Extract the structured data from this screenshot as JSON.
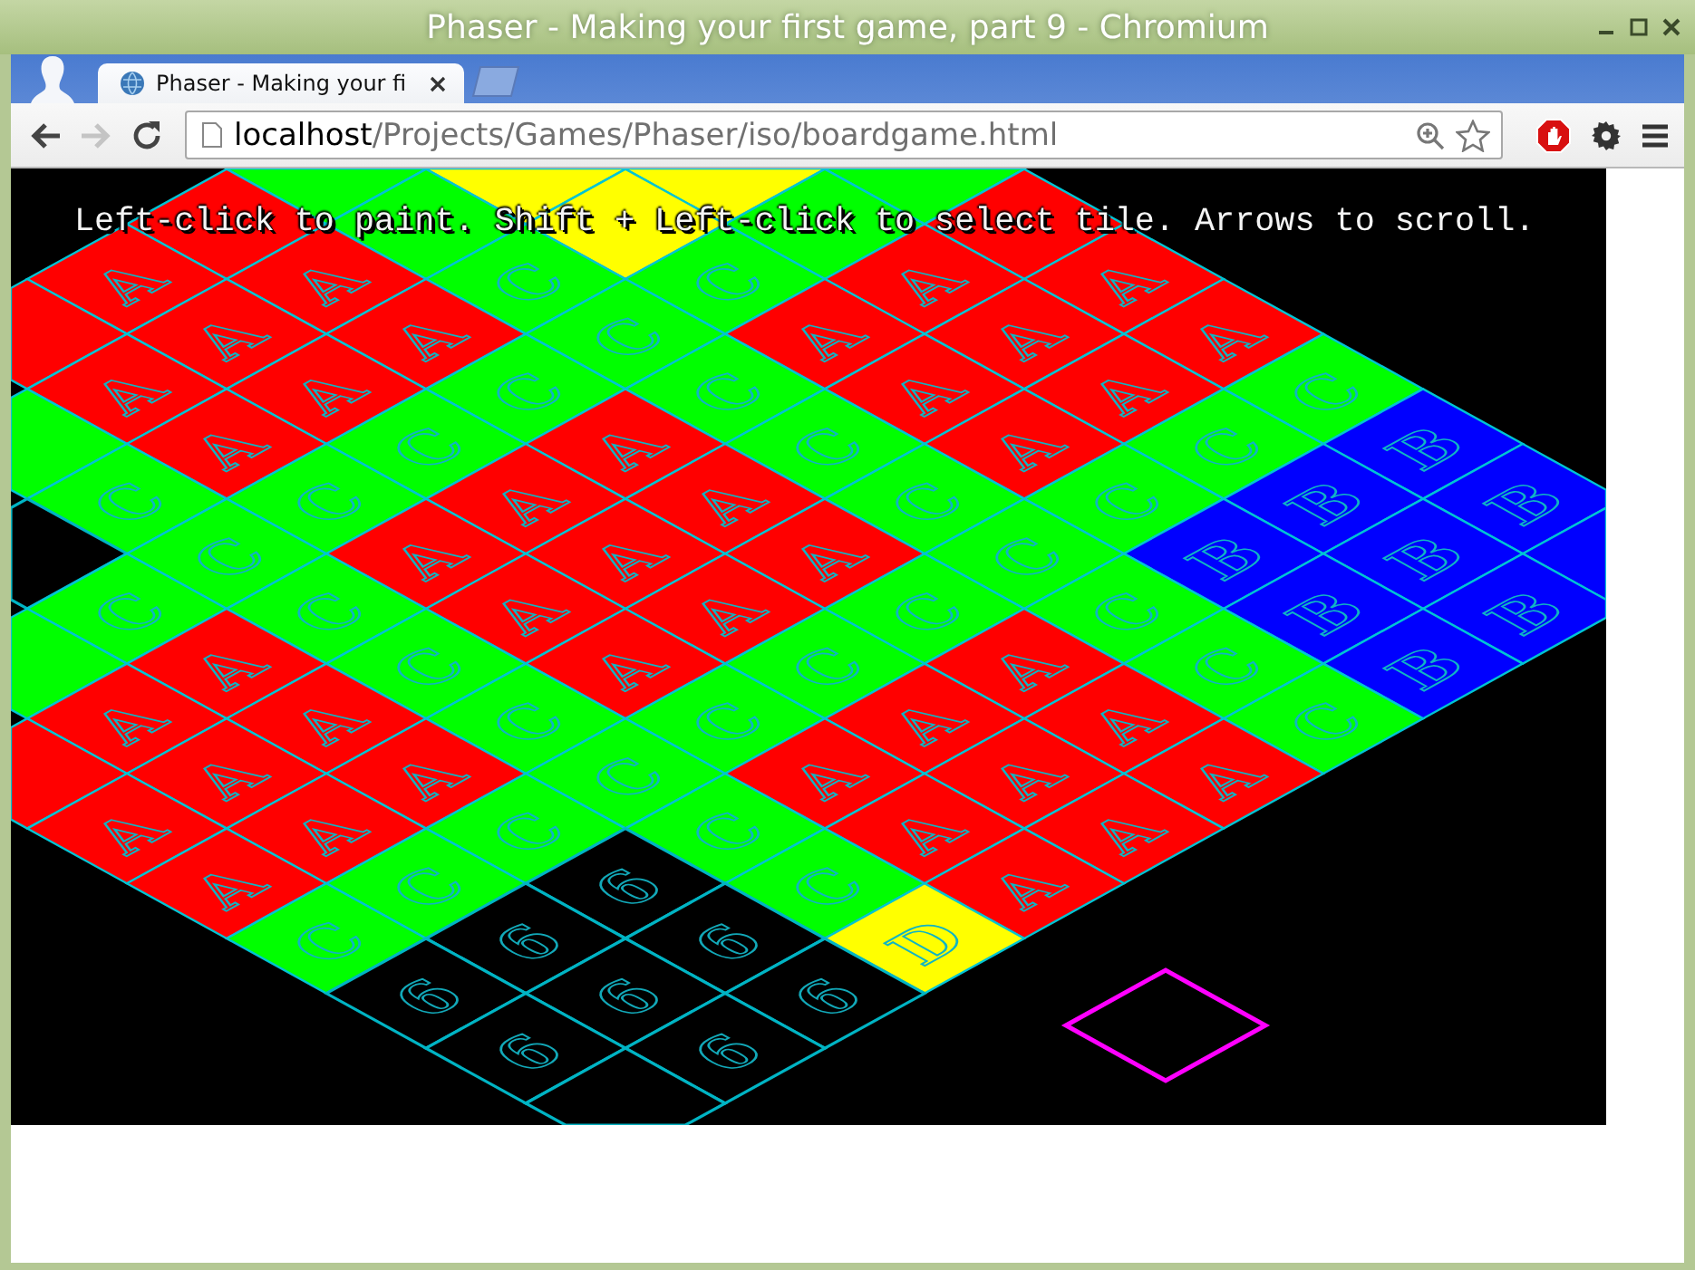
{
  "window": {
    "title": "Phaser - Making your first game, part 9 - Chromium"
  },
  "tabs": [
    {
      "title": "Phaser - Making your fi",
      "selected": true
    }
  ],
  "toolbar": {
    "back": {
      "disabled": false
    },
    "forward": {
      "disabled": true
    }
  },
  "address": {
    "host": "localhost",
    "path": "/Projects/Games/Phaser/iso/boardgame.html"
  },
  "game": {
    "hint": "Left-click to paint. Shift + Left-click to select tile. Arrows to scroll.",
    "board": {
      "rows": [
        [
          {
            "kind": "none"
          },
          {
            "kind": "filled",
            "color": "#00ff00"
          },
          {
            "kind": "filled",
            "color": "#ffff00"
          },
          {
            "kind": "filled",
            "color": "#ffff00"
          },
          {
            "kind": "filled",
            "color": "#00ff00"
          }
        ],
        [
          {
            "kind": "none"
          },
          {
            "kind": "filled",
            "color": "#ff0000"
          },
          {
            "kind": "filled",
            "color": "#00ff00"
          },
          {
            "kind": "filled",
            "color": "#ffff00"
          },
          {
            "kind": "filled",
            "color": "#00ff00"
          },
          {
            "kind": "filled",
            "color": "#ff0000"
          }
        ],
        [
          {
            "kind": "filled",
            "color": "#ff0000",
            "letter": "A"
          },
          {
            "kind": "filled",
            "color": "#ff0000",
            "letter": "A"
          },
          {
            "kind": "filled",
            "color": "#00ff00",
            "letter": "C"
          },
          {
            "kind": "filled",
            "color": "#00ff00",
            "letter": "C"
          },
          {
            "kind": "filled",
            "color": "#ff0000",
            "letter": "A"
          },
          {
            "kind": "filled",
            "color": "#ff0000",
            "letter": "A"
          }
        ],
        [
          {
            "kind": "filled",
            "color": "#ff0000"
          },
          {
            "kind": "filled",
            "color": "#ff0000",
            "letter": "A"
          },
          {
            "kind": "filled",
            "color": "#ff0000",
            "letter": "A"
          },
          {
            "kind": "filled",
            "color": "#00ff00",
            "letter": "C"
          },
          {
            "kind": "filled",
            "color": "#ff0000",
            "letter": "A"
          },
          {
            "kind": "filled",
            "color": "#ff0000",
            "letter": "A"
          },
          {
            "kind": "filled",
            "color": "#ff0000",
            "letter": "A"
          }
        ],
        [
          {
            "kind": "filled",
            "color": "#ff0000",
            "letter": "A"
          },
          {
            "kind": "filled",
            "color": "#ff0000",
            "letter": "A"
          },
          {
            "kind": "filled",
            "color": "#00ff00",
            "letter": "C"
          },
          {
            "kind": "filled",
            "color": "#00ff00",
            "letter": "C"
          },
          {
            "kind": "filled",
            "color": "#ff0000",
            "letter": "A"
          },
          {
            "kind": "filled",
            "color": "#ff0000",
            "letter": "A"
          },
          {
            "kind": "filled",
            "color": "#00ff00",
            "letter": "C"
          }
        ],
        [
          {
            "kind": "filled",
            "color": "#00ff00"
          },
          {
            "kind": "filled",
            "color": "#ff0000",
            "letter": "A"
          },
          {
            "kind": "filled",
            "color": "#00ff00",
            "letter": "C"
          },
          {
            "kind": "filled",
            "color": "#ff0000",
            "letter": "A"
          },
          {
            "kind": "filled",
            "color": "#00ff00",
            "letter": "C"
          },
          {
            "kind": "filled",
            "color": "#ff0000",
            "letter": "A"
          },
          {
            "kind": "filled",
            "color": "#00ff00",
            "letter": "C"
          },
          {
            "kind": "filled",
            "color": "#0000ff",
            "letter": "B"
          }
        ],
        [
          {
            "kind": "filled",
            "color": "#00ff00",
            "letter": "C"
          },
          {
            "kind": "filled",
            "color": "#00ff00",
            "letter": "C"
          },
          {
            "kind": "filled",
            "color": "#ff0000",
            "letter": "A"
          },
          {
            "kind": "filled",
            "color": "#ff0000",
            "letter": "A"
          },
          {
            "kind": "filled",
            "color": "#00ff00",
            "letter": "C"
          },
          {
            "kind": "filled",
            "color": "#00ff00",
            "letter": "C"
          },
          {
            "kind": "filled",
            "color": "#0000ff",
            "letter": "B"
          },
          {
            "kind": "filled",
            "color": "#0000ff",
            "letter": "B"
          }
        ],
        [
          {
            "kind": "outline"
          },
          {
            "kind": "filled",
            "color": "#00ff00",
            "letter": "C"
          },
          {
            "kind": "filled",
            "color": "#ff0000",
            "letter": "A"
          },
          {
            "kind": "filled",
            "color": "#ff0000",
            "letter": "A"
          },
          {
            "kind": "filled",
            "color": "#ff0000",
            "letter": "A"
          },
          {
            "kind": "filled",
            "color": "#00ff00",
            "letter": "C"
          },
          {
            "kind": "filled",
            "color": "#0000ff",
            "letter": "B"
          },
          {
            "kind": "filled",
            "color": "#0000ff",
            "letter": "B"
          },
          {
            "kind": "filled",
            "color": "#0000ff"
          }
        ],
        [
          {
            "kind": "filled",
            "color": "#00ff00",
            "letter": "C"
          },
          {
            "kind": "filled",
            "color": "#00ff00",
            "letter": "C"
          },
          {
            "kind": "filled",
            "color": "#ff0000",
            "letter": "A"
          },
          {
            "kind": "filled",
            "color": "#ff0000",
            "letter": "A"
          },
          {
            "kind": "filled",
            "color": "#00ff00",
            "letter": "C"
          },
          {
            "kind": "filled",
            "color": "#00ff00",
            "letter": "C"
          },
          {
            "kind": "filled",
            "color": "#0000ff",
            "letter": "B"
          },
          {
            "kind": "filled",
            "color": "#0000ff",
            "letter": "B"
          }
        ],
        [
          {
            "kind": "filled",
            "color": "#00ff00"
          },
          {
            "kind": "filled",
            "color": "#ff0000",
            "letter": "A"
          },
          {
            "kind": "filled",
            "color": "#00ff00",
            "letter": "C"
          },
          {
            "kind": "filled",
            "color": "#ff0000",
            "letter": "A"
          },
          {
            "kind": "filled",
            "color": "#00ff00",
            "letter": "C"
          },
          {
            "kind": "filled",
            "color": "#ff0000",
            "letter": "A"
          },
          {
            "kind": "filled",
            "color": "#00ff00",
            "letter": "C"
          },
          {
            "kind": "filled",
            "color": "#0000ff",
            "letter": "B"
          }
        ],
        [
          {
            "kind": "filled",
            "color": "#ff0000",
            "letter": "A"
          },
          {
            "kind": "filled",
            "color": "#ff0000",
            "letter": "A"
          },
          {
            "kind": "filled",
            "color": "#00ff00",
            "letter": "C"
          },
          {
            "kind": "filled",
            "color": "#00ff00",
            "letter": "C"
          },
          {
            "kind": "filled",
            "color": "#ff0000",
            "letter": "A"
          },
          {
            "kind": "filled",
            "color": "#ff0000",
            "letter": "A"
          },
          {
            "kind": "filled",
            "color": "#00ff00",
            "letter": "C"
          }
        ],
        [
          {
            "kind": "filled",
            "color": "#ff0000"
          },
          {
            "kind": "filled",
            "color": "#ff0000",
            "letter": "A"
          },
          {
            "kind": "filled",
            "color": "#ff0000",
            "letter": "A"
          },
          {
            "kind": "filled",
            "color": "#00ff00",
            "letter": "C"
          },
          {
            "kind": "filled",
            "color": "#ff0000",
            "letter": "A"
          },
          {
            "kind": "filled",
            "color": "#ff0000",
            "letter": "A"
          },
          {
            "kind": "filled",
            "color": "#ff0000",
            "letter": "A"
          }
        ],
        [
          {
            "kind": "filled",
            "color": "#ff0000",
            "letter": "A"
          },
          {
            "kind": "filled",
            "color": "#ff0000",
            "letter": "A"
          },
          {
            "kind": "filled",
            "color": "#00ff00",
            "letter": "C"
          },
          {
            "kind": "filled",
            "color": "#00ff00",
            "letter": "C"
          },
          {
            "kind": "filled",
            "color": "#ff0000",
            "letter": "A"
          },
          {
            "kind": "filled",
            "color": "#ff0000",
            "letter": "A"
          }
        ],
        [
          {
            "kind": "none"
          },
          {
            "kind": "filled",
            "color": "#ff0000",
            "letter": "A"
          },
          {
            "kind": "filled",
            "color": "#00ff00",
            "letter": "C"
          },
          {
            "kind": "outline",
            "letter": "6"
          },
          {
            "kind": "filled",
            "color": "#00ff00",
            "letter": "C"
          },
          {
            "kind": "filled",
            "color": "#ff0000",
            "letter": "A"
          }
        ],
        [
          {
            "kind": "none"
          },
          {
            "kind": "filled",
            "color": "#00ff00",
            "letter": "C"
          },
          {
            "kind": "outline",
            "letter": "6"
          },
          {
            "kind": "outline",
            "letter": "6"
          },
          {
            "kind": "filled",
            "color": "#ffff00",
            "letter": "D"
          }
        ],
        [
          {
            "kind": "none"
          },
          {
            "kind": "none"
          },
          {
            "kind": "outline",
            "letter": "6"
          },
          {
            "kind": "outline",
            "letter": "6"
          },
          {
            "kind": "outline",
            "letter": "6"
          }
        ],
        [
          {
            "kind": "none"
          },
          {
            "kind": "none"
          },
          {
            "kind": "outline",
            "letter": "6"
          },
          {
            "kind": "outline",
            "letter": "6"
          }
        ],
        [
          {
            "kind": "none"
          },
          {
            "kind": "none"
          },
          {
            "kind": "none"
          },
          {
            "kind": "outline"
          }
        ]
      ]
    }
  }
}
